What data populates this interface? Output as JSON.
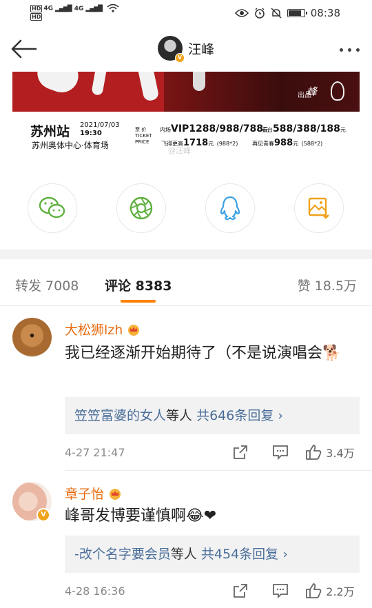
{
  "status_bar": {
    "time": "08:38",
    "hd_label": "HD",
    "net1": "4G",
    "net2": "4G",
    "battery_level": 0.85
  },
  "header": {
    "author_name": "汪峰",
    "verified_badge": "V"
  },
  "poster": {
    "credit_label": "出品",
    "signature": "峰"
  },
  "ticket": {
    "city": "苏州站",
    "date": "2021/07/03",
    "time": "19:30",
    "venue": "苏州奥体中心·体育场",
    "price_label_cn": "票 价",
    "price_label_en1": "TICKET",
    "price_label_en2": "PRICE",
    "inner_label": "内场",
    "inner_prices": "VIP1288/988/788",
    "stand_label": "看台",
    "stand_prices": "588/388/188",
    "yuan": "元",
    "flyer_label": "飞得更高",
    "flyer_price": "1718",
    "flyer_note": "(988*2)",
    "youth_label": "再见青春",
    "youth_price": "988",
    "youth_note": "(588*2)",
    "watermark": "@汪峰"
  },
  "share": [
    {
      "icon": "wechat-icon",
      "color": "#5fb13f"
    },
    {
      "icon": "moments-icon",
      "color": "#5fb13f"
    },
    {
      "icon": "qq-icon",
      "color": "#3aa0e6"
    },
    {
      "icon": "save-image-icon",
      "color": "#f0a21b"
    }
  ],
  "tabs": {
    "repost": "转发 7008",
    "comments": "评论 8383",
    "likes": "赞 18.5万"
  },
  "comments": [
    {
      "author": "大松狮lzh",
      "text": "我已经逐渐开始期待了（不是说演唱会",
      "emoji": "🐕",
      "reply_user": "笠笠富婆的女人",
      "reply_middle": "等人",
      "reply_count": "共646条回复",
      "time": "4-27 21:47",
      "likes": "3.4万"
    },
    {
      "author": "章子怡",
      "text": "峰哥发博要谨慎啊",
      "emoji": "😂❤",
      "reply_user": "-改个名字要会员",
      "reply_middle": "等人",
      "reply_count": "共454条回复",
      "time": "4-28 16:36",
      "likes": "2.2万"
    }
  ],
  "colors": {
    "accent": "#ff8200",
    "username": "#e86b0f",
    "link": "#4a6e9a"
  }
}
